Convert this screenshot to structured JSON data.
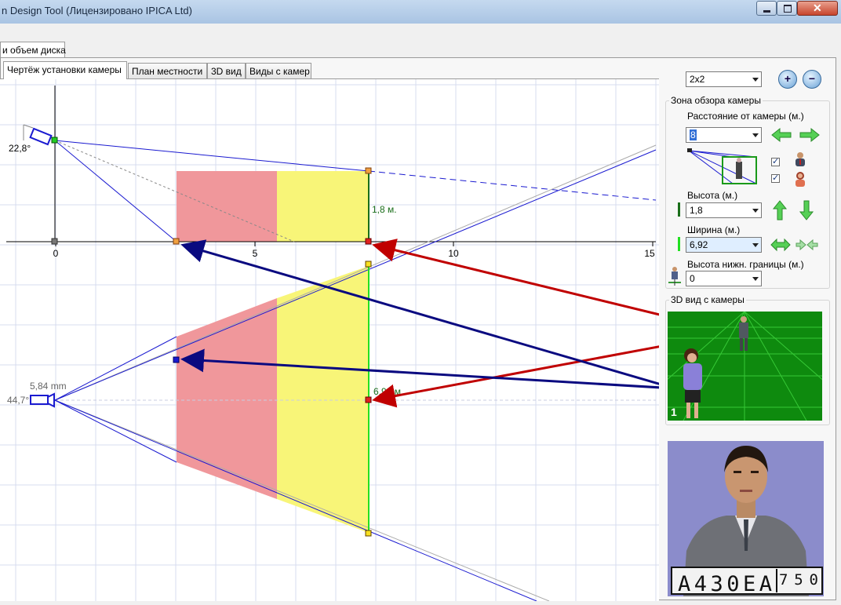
{
  "window": {
    "title": "n Design Tool (Лицензировано  IPICA Ltd)",
    "outer_tab": "и объем диска"
  },
  "tabs": [
    {
      "label": "Чертёж установки камеры",
      "active": true
    },
    {
      "label": "План местности",
      "active": false
    },
    {
      "label": "3D вид",
      "active": false
    },
    {
      "label": "Виды с камер",
      "active": false
    }
  ],
  "drawing": {
    "side_view": {
      "tilt_angle": "22,8°",
      "height_label": "1,8 м.",
      "axis_ticks": [
        "0",
        "5",
        "10",
        "15"
      ]
    },
    "top_view": {
      "focal_length": "5,84 mm",
      "view_angle": "44,7°",
      "width_label": "6,92 м."
    },
    "colors": {
      "red_zone": "#f0979b",
      "yellow_zone": "#f8f578",
      "frustum": "#1a1ad0",
      "height_line": "#1a6e1a",
      "width_line": "#22e022",
      "pointer_red": "#c00000",
      "pointer_blue": "#0a0a80"
    }
  },
  "right_panel": {
    "layout_select": "2x2",
    "zoom_in_icon": "zoom-in-icon",
    "zoom_out_icon": "zoom-out-icon",
    "coverage_group": {
      "title": "Зона обзора камеры",
      "distance_label": "Расстояние от камеры (м.)",
      "distance_value": "8",
      "height_label": "Высота (м.)",
      "height_value": "1,8",
      "width_label": "Ширина (м.)",
      "width_value": "6,92",
      "lower_bound_label": "Высота нижн. границы (м.)",
      "lower_bound_value": "0",
      "male_checked": true,
      "female_checked": true
    },
    "view3d_group": {
      "title": "3D вид с камеры",
      "camera_index": "1"
    },
    "plate": {
      "text": "А430ЕА",
      "region": "750"
    }
  }
}
